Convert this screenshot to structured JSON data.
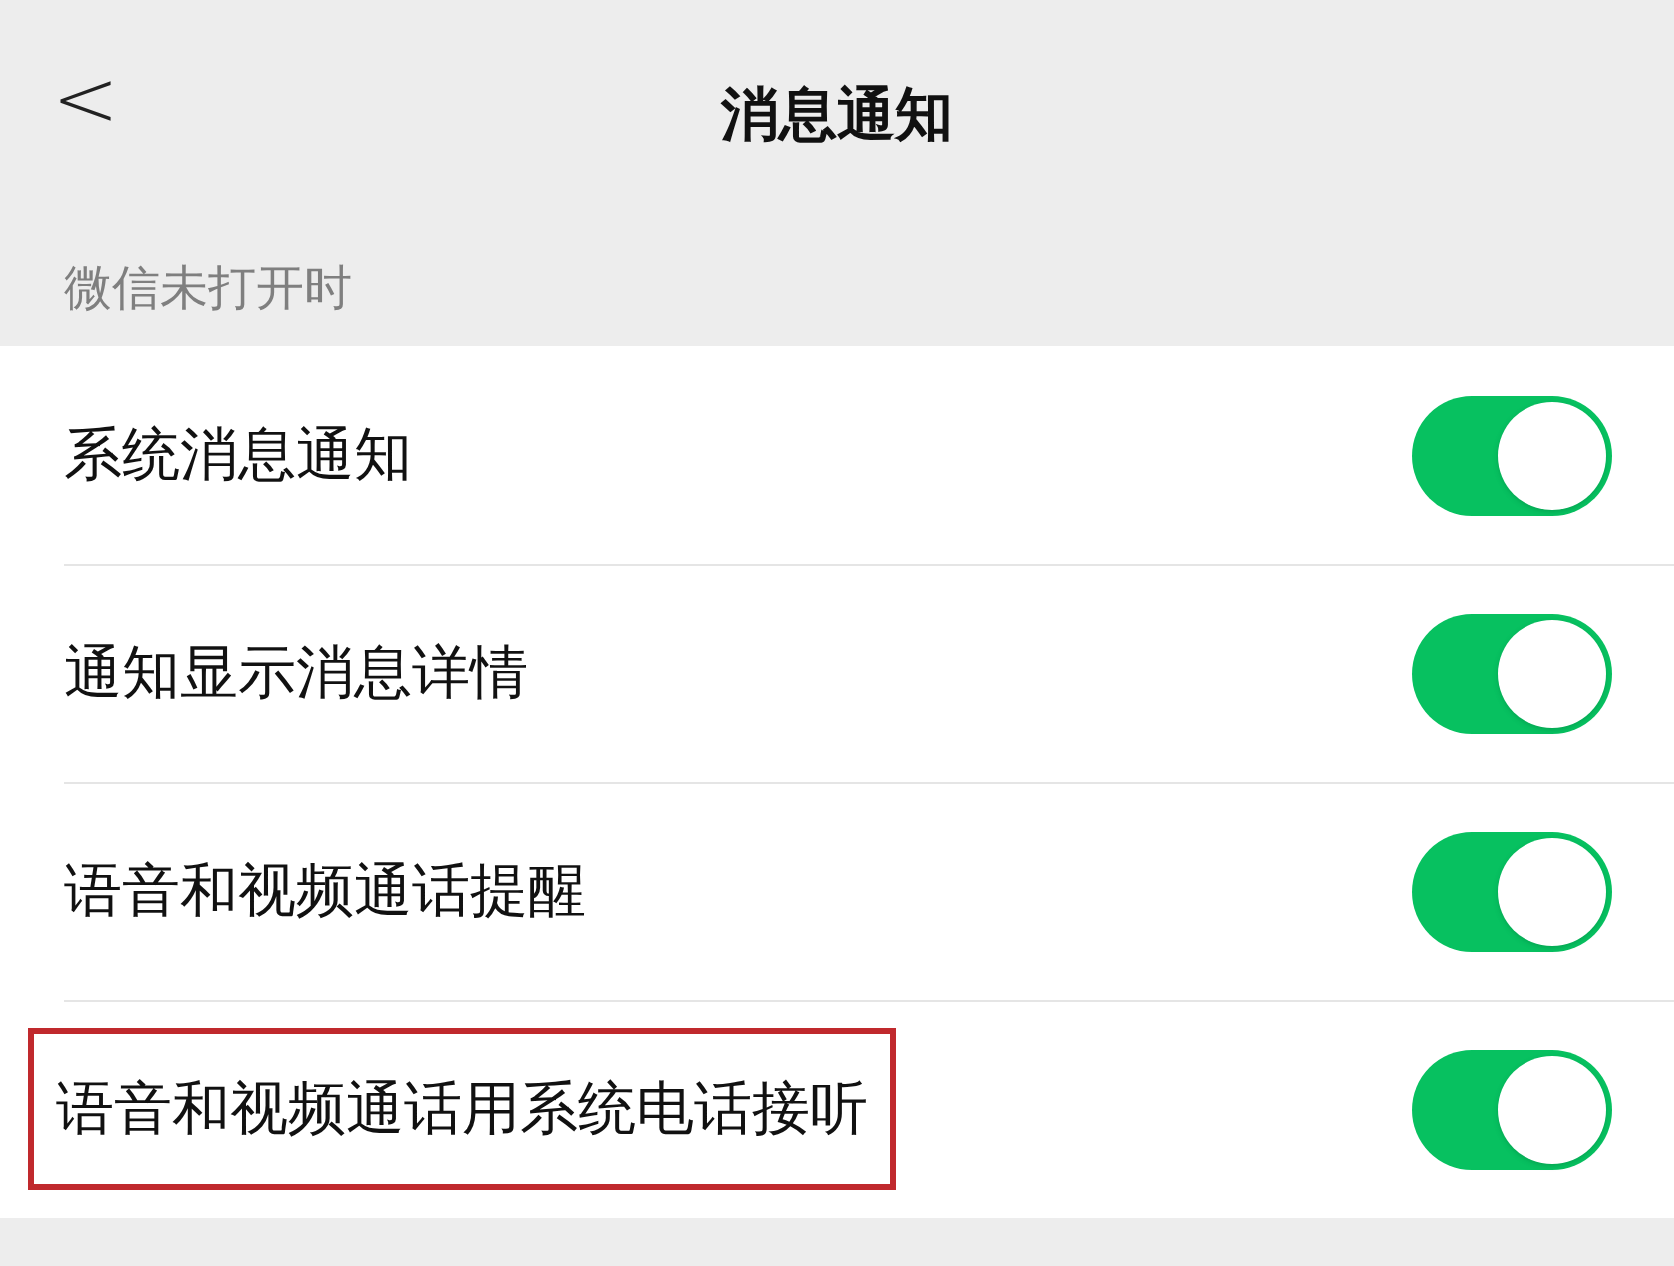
{
  "header": {
    "back": "<",
    "title": "消息通知"
  },
  "section": {
    "label": "微信未打开时"
  },
  "rows": [
    {
      "label": "系统消息通知",
      "on": true,
      "highlighted": false
    },
    {
      "label": "通知显示消息详情",
      "on": true,
      "highlighted": false
    },
    {
      "label": "语音和视频通话提醒",
      "on": true,
      "highlighted": false
    },
    {
      "label": "语音和视频通话用系统电话接听",
      "on": true,
      "highlighted": true
    }
  ]
}
